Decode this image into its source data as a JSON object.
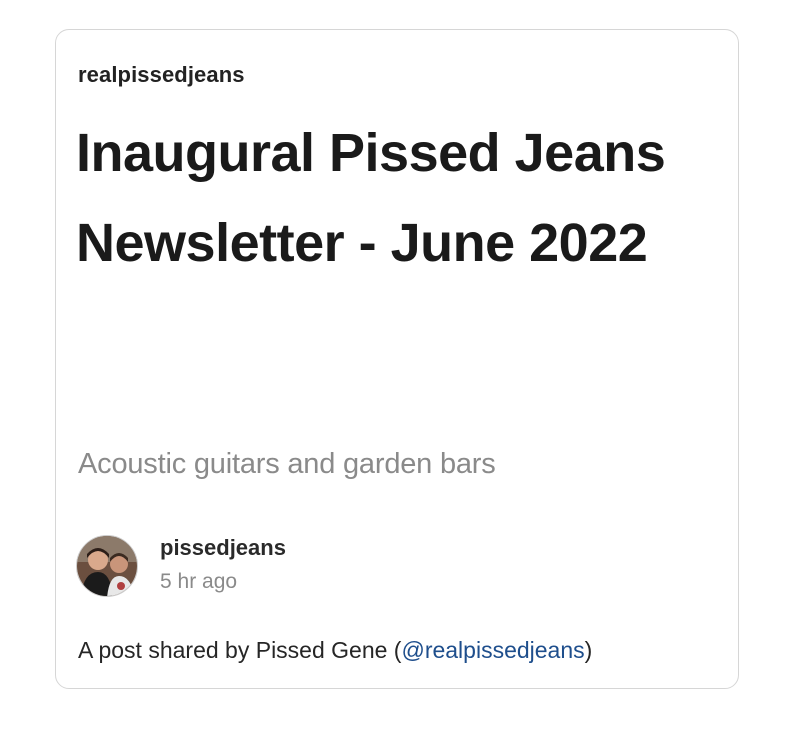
{
  "embed": {
    "account_name": "realpissedjeans",
    "post_title": "Inaugural Pissed Jeans Newsletter - June 2022",
    "subtitle": "Acoustic guitars and garden bars",
    "author": {
      "name": "pissedjeans",
      "time": "5 hr ago",
      "avatar_icon": "profile-photo"
    },
    "caption": {
      "prefix": "A post shared by Pissed Gene (",
      "handle": "@realpissedjeans",
      "suffix": ")"
    }
  },
  "colors": {
    "border": "#d6d6d6",
    "link": "#1e4e8c",
    "muted": "#8a8a8a"
  }
}
